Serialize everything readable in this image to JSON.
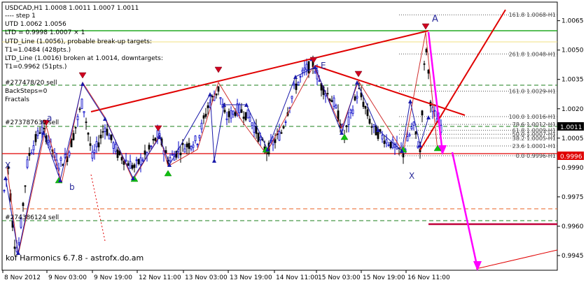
{
  "chart_data": {
    "type": "candlestick",
    "symbol_header": "USDCAD,H1  1.0008 1.0011 1.0007 1.0011",
    "info_lines": [
      "---- step 1",
      "UTD 1.0062  1.0056",
      "LTD = 0.9998  1.0007  × 1",
      "UTD_Line (1.0056), probable break-up targets:",
      "T1=1.0484 (428pts.)",
      "LTD_Line (1.0016) broken at 1.0014, downtargets:",
      "T1=0.9962 (51pts.)"
    ],
    "indicator_labels": [
      "#277478/20 sell",
      "BackSteps=0",
      "Fractals"
    ],
    "order_labels": [
      "#273787630 sell",
      "#274386124 sell"
    ],
    "watermark": "kof Harmonics 6.7.8 - astrofx.do.am",
    "pattern_letters": [
      "X",
      "a",
      "b",
      "E",
      "X",
      "A"
    ],
    "fib_levels": [
      {
        "label": "161.8 1.0068-H1",
        "price": 1.0068
      },
      {
        "label": "261.8 1.0048-H1",
        "price": 1.0048
      },
      {
        "label": "161.0 1.0029-H1",
        "price": 1.0029
      },
      {
        "label": "100.0 1.0016-H1",
        "price": 1.0016
      },
      {
        "label": "78.6 1.0012-H1",
        "price": 1.0012
      },
      {
        "label": "61.8 1.0009-H1",
        "price": 1.0009
      },
      {
        "label": "50.0 1.0007-H1",
        "price": 1.0007
      },
      {
        "label": "38.2 1.0005-H1",
        "price": 1.0005
      },
      {
        "label": "23.6 1.0001-H1",
        "price": 1.0001
      },
      {
        "label": "0.0 0.9996-H1",
        "price": 0.9996
      }
    ],
    "current_price": "1.0011",
    "level_price": "0.9996",
    "y_ticks": [
      "1.0065",
      "1.0050",
      "1.0035",
      "1.0020",
      "1.0005",
      "0.9990",
      "0.9975",
      "0.9960",
      "0.9945"
    ],
    "y_range": [
      0.99375,
      1.00745
    ],
    "x_ticks": [
      "8 Nov 2012",
      "9 Nov 03:00",
      "9 Nov 19:00",
      "12 Nov 11:00",
      "13 Nov 03:00",
      "13 Nov 19:00",
      "14 Nov 11:00",
      "15 Nov 03:00",
      "15 Nov 19:00",
      "16 Nov 11:00"
    ],
    "colors": {
      "bull_candle": "#0000c8",
      "bear_candle": "#000000",
      "channel": "#e00000",
      "zigzag": "#1a1aaa",
      "target_arrow": "#ff00ff",
      "fractal_up": "#10c010",
      "fractal_down": "#d00020",
      "utd_line": "#22aa22",
      "current_price_bg": "#000000",
      "level_bg": "#e00000"
    }
  }
}
